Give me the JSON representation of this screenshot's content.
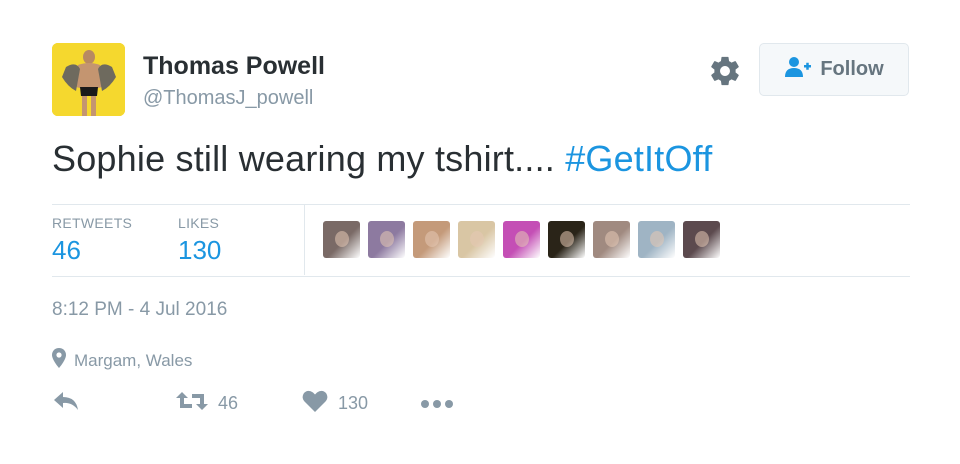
{
  "user": {
    "name": "Thomas Powell",
    "handle": "@ThomasJ_powell"
  },
  "follow_button": {
    "label": "Follow"
  },
  "tweet": {
    "text": "Sophie still wearing my tshirt.... ",
    "hashtag": "#GetItOff"
  },
  "stats": {
    "retweets_label": "RETWEETS",
    "retweets_value": "46",
    "likes_label": "LIKES",
    "likes_value": "130"
  },
  "likers": [
    {
      "icon": "liker-avatar-1",
      "color": "#7a6a66"
    },
    {
      "icon": "liker-avatar-2",
      "color": "#8d7aa0"
    },
    {
      "icon": "liker-avatar-3",
      "color": "#c49a7a"
    },
    {
      "icon": "liker-avatar-4",
      "color": "#d9c6a4"
    },
    {
      "icon": "liker-avatar-5",
      "color": "#c44fb5"
    },
    {
      "icon": "liker-avatar-6",
      "color": "#2a2418"
    },
    {
      "icon": "liker-avatar-7",
      "color": "#a08a80"
    },
    {
      "icon": "liker-avatar-8",
      "color": "#9fb4c4"
    },
    {
      "icon": "liker-avatar-9",
      "color": "#5c4a4e"
    }
  ],
  "timestamp": "8:12 PM - 4 Jul 2016",
  "location": "Margam, Wales",
  "actions": {
    "retweet_count": "46",
    "like_count": "130"
  },
  "colors": {
    "link": "#1b95e0",
    "muted": "#8899a6",
    "text": "#292f33",
    "avatar_bg": "#f2d11a"
  }
}
